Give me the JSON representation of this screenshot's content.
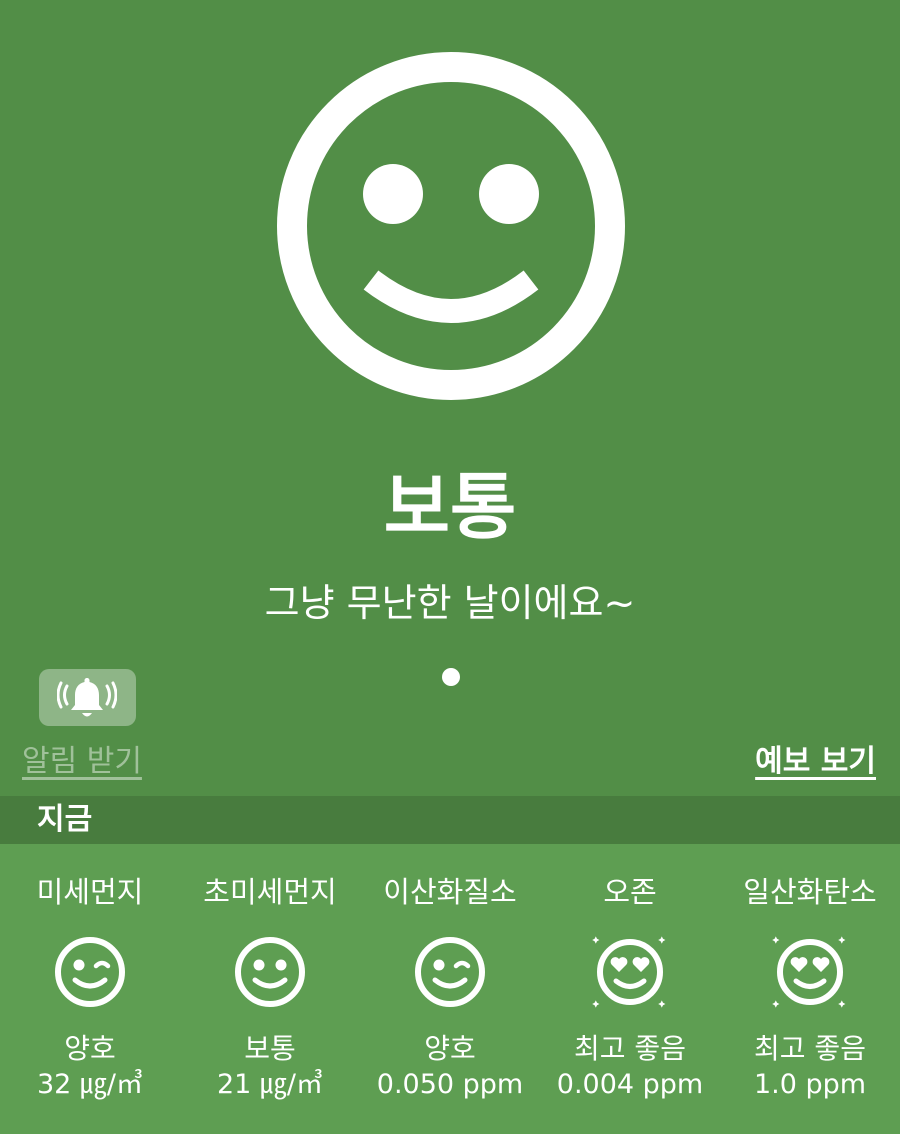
{
  "hero": {
    "face_icon": "smiley-face-icon",
    "status": "보통",
    "message": "그냥 무난한 날이에요~",
    "page_indicator_current": 1,
    "page_indicator_total": 1
  },
  "alarm": {
    "icon": "bell-ringing-icon",
    "label": "알림 받기"
  },
  "forecast": {
    "label": "예보 보기"
  },
  "section": {
    "title": "지금"
  },
  "pollutants": [
    {
      "name": "미세먼지",
      "icon": "winking-face-icon",
      "status": "양호",
      "value": "32 ㎍/㎥"
    },
    {
      "name": "초미세먼지",
      "icon": "smiley-face-icon",
      "status": "보통",
      "value": "21 ㎍/㎥"
    },
    {
      "name": "이산화질소",
      "icon": "winking-face-icon",
      "status": "양호",
      "value": "0.050 ppm"
    },
    {
      "name": "오존",
      "icon": "heart-eyes-face-icon",
      "status": "최고 좋음",
      "value": "0.004 ppm"
    },
    {
      "name": "일산화탄소",
      "icon": "heart-eyes-face-icon",
      "status": "최고 좋음",
      "value": "1.0 ppm"
    }
  ],
  "colors": {
    "background": "#528e47",
    "section_bar": "#487c3e",
    "panel": "#5e9e52",
    "foreground": "#ffffff"
  }
}
